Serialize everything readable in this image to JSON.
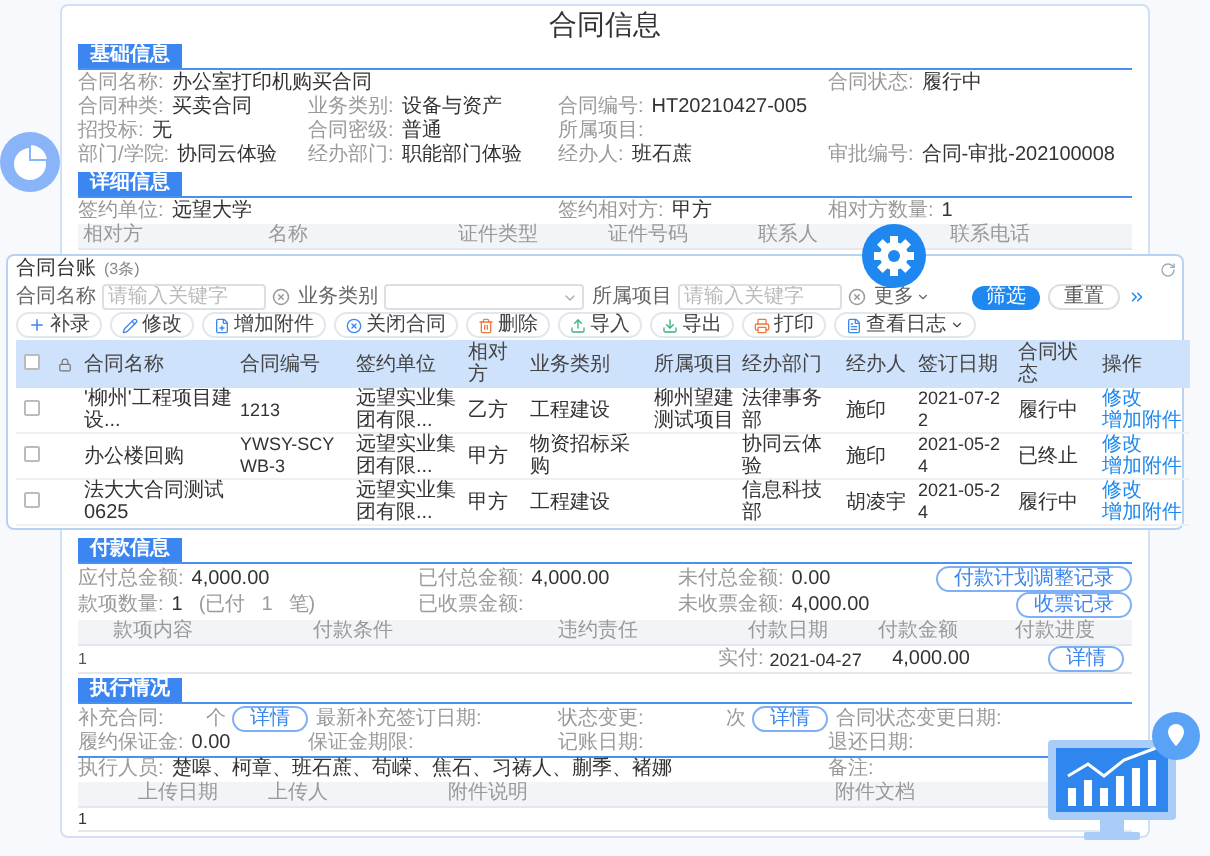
{
  "title": "合同信息",
  "basic": {
    "tab": "基础信息",
    "rows": [
      [
        {
          "label": "合同名称:",
          "value": "办公室打印机购买合同"
        },
        "",
        "",
        {
          "label": "合同状态:",
          "value": "履行中"
        }
      ],
      [
        {
          "label": "合同种类:",
          "value": "买卖合同"
        },
        {
          "label": "业务类别:",
          "value": "设备与资产"
        },
        {
          "label": "合同编号:",
          "value": "HT20210427-005"
        }
      ],
      [
        {
          "label": "招投标:",
          "value": "无"
        },
        {
          "label": "合同密级:",
          "value": "普通"
        },
        {
          "label": "所属项目:"
        }
      ],
      [
        {
          "label": "部门/学院:",
          "value": "协同云体验"
        },
        {
          "label": "经办部门:",
          "value": "职能部门体验"
        },
        {
          "label": "经办人:",
          "value": "班石蔗"
        },
        {
          "label": "审批编号:",
          "value": "合同-审批-202100008"
        }
      ]
    ]
  },
  "detail": {
    "tab": "详细信息",
    "fields": [
      {
        "label": "签约单位:",
        "value": "远望大学"
      },
      {
        "label": "签约相对方:",
        "value": "甲方"
      },
      {
        "label": "相对方数量:",
        "value": "1"
      }
    ],
    "columns": [
      "相对方",
      "名称",
      "证件类型",
      "证件号码",
      "联系人",
      "联系电话"
    ]
  },
  "ledger": {
    "title": "合同台账",
    "count": "(3条)",
    "filters": [
      {
        "kind": "input",
        "label": "合同名称",
        "placeholder": "请输入关键字"
      },
      {
        "kind": "select",
        "label": "业务类别"
      },
      {
        "kind": "input",
        "label": "所属项目",
        "placeholder": "请输入关键字"
      }
    ],
    "more": "更多",
    "search_button": "筛选",
    "reset_button": "重置",
    "toolbar": [
      "补录",
      "修改",
      "增加附件",
      "关闭合同",
      "删除",
      "导入",
      "导出",
      "打印",
      "查看日志"
    ],
    "all_checked": false,
    "columns": [
      "合同名称",
      "合同编号",
      "签约单位",
      "相对方",
      "业务类别",
      "所属项目",
      "经办部门",
      "经办人",
      "签订日期",
      "合同状态",
      "操作"
    ],
    "rows": [
      {
        "checked": false,
        "cells": [
          "'柳州'工程项目建设...",
          "1213",
          "远望实业集团有限...",
          "乙方",
          "工程建设",
          "柳州望建测试项目",
          "法律事务部",
          "施印",
          "2021-07-22",
          "履行中"
        ],
        "actions": [
          "修改",
          "增加附件"
        ]
      },
      {
        "checked": false,
        "cells": [
          "办公楼回购",
          "YWSY-SCYWB-3",
          "远望实业集团有限...",
          "甲方",
          "物资招标采购",
          "",
          "协同云体验",
          "施印",
          "2021-05-24",
          "已终止"
        ],
        "actions": [
          "修改",
          "增加附件"
        ]
      },
      {
        "checked": false,
        "cells": [
          "法大大合同测试0625",
          "",
          "远望实业集团有限...",
          "甲方",
          "工程建设",
          "",
          "信息科技部",
          "胡凌宇",
          "2021-05-24",
          "履行中"
        ],
        "actions": [
          "修改",
          "增加附件"
        ]
      }
    ]
  },
  "payment": {
    "tab": "付款信息",
    "rows": [
      {
        "fields": [
          {
            "label": "应付总金额:",
            "value": "4,000.00"
          },
          {
            "label": "已付总金额:",
            "value": "4,000.00"
          },
          {
            "label": "未付总金额:",
            "value": "0.00"
          }
        ],
        "button": "付款计划调整记录"
      },
      {
        "fields": [
          {
            "label": "款项数量:",
            "value": "1",
            "extra": [
              "(已付",
              "1",
              "笔)"
            ]
          },
          {
            "label": "已收票金额:"
          },
          {
            "label": "未收票金额:",
            "value": "4,000.00"
          }
        ],
        "button": "收票记录"
      }
    ],
    "columns": [
      "款项内容",
      "付款条件",
      "违约责任",
      "付款日期",
      "付款金额",
      "付款进度"
    ],
    "row": {
      "index": "1",
      "date_label": "实付:",
      "date": "2021-04-27",
      "amount": "4,000.00",
      "button": "详情"
    }
  },
  "execution": {
    "tab": "执行情况",
    "counters": [
      {
        "label": "补充合同:",
        "unit": "个",
        "button": "详情",
        "date_label": "最新补充签订日期:"
      },
      {
        "label": "状态变更:",
        "unit": "次",
        "button": "详情",
        "date_label": "合同状态变更日期:"
      }
    ],
    "fields": [
      {
        "label": "履约保证金:",
        "value": "0.00"
      },
      {
        "label": "保证金期限:"
      },
      {
        "label": "记账日期:"
      },
      {
        "label": "退还日期:"
      }
    ]
  },
  "attachments": {
    "fields": [
      {
        "label": "执行人员:",
        "value": "楚嗥、柯章、班石蔗、苟嵘、焦石、习祷人、蒯季、褚娜"
      },
      {
        "label": "备注:"
      }
    ],
    "columns": [
      "上传日期",
      "上传人",
      "附件说明",
      "附件文档"
    ],
    "rows": [
      "1"
    ]
  }
}
